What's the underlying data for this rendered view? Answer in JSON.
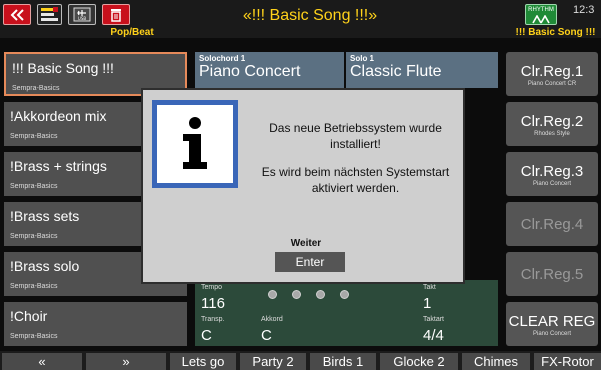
{
  "header": {
    "title": "«!!! Basic Song !!!»",
    "left_label": "Pop/Beat",
    "right_label": "!!! Basic Song !!!",
    "clock": "12:3",
    "icons": [
      "double-left-icon",
      "menu-icon",
      "usb-icon",
      "trash-icon",
      "rhythm-icon"
    ],
    "usb_label": "USB",
    "rhythm_label": "RHYTHM"
  },
  "songs": [
    {
      "name": "!!! Basic Song !!!",
      "sub": "Sempra-Basics",
      "active": true
    },
    {
      "name": "!Akkordeon mix",
      "sub": "Sempra-Basics"
    },
    {
      "name": "!Brass + strings",
      "sub": "Sempra-Basics"
    },
    {
      "name": "!Brass sets",
      "sub": "Sempra-Basics"
    },
    {
      "name": "!Brass solo",
      "sub": "Sempra-Basics"
    },
    {
      "name": "!Choir",
      "sub": "Sempra-Basics"
    }
  ],
  "panels": {
    "solochord_label": "Solochord 1",
    "solochord_value": "Piano Concert",
    "solo_label": "Solo 1",
    "solo_value": "Classic Flute",
    "tempo_label": "Tempo",
    "tempo_value": "116",
    "takt_label": "Takt",
    "takt_value": "1",
    "transp_label": "Transp.",
    "transp_value": "C",
    "akkord_label": "Akkord",
    "akkord_value": "C",
    "taktart_label": "Taktart",
    "taktart_value": "4/4"
  },
  "registrations": [
    {
      "name": "Clr.Reg.1",
      "sub": "Piano Concert CR"
    },
    {
      "name": "Clr.Reg.2",
      "sub": "Rhodes Style"
    },
    {
      "name": "Clr.Reg.3",
      "sub": "Piano Concert"
    },
    {
      "name": "Clr.Reg.4",
      "sub": "",
      "dim": true
    },
    {
      "name": "Clr.Reg.5",
      "sub": "",
      "dim": true
    },
    {
      "name": "CLEAR REG",
      "sub": "Piano Concert"
    }
  ],
  "dialog": {
    "line1": "Das neue Betriebssystem wurde",
    "line2": "installiert!",
    "line3": "Es wird beim nächsten Systemstart",
    "line4": "aktiviert werden.",
    "weiter": "Weiter",
    "enter": "Enter",
    "icon": "info-icon"
  },
  "bottom": {
    "scroll_up": "«",
    "scroll_down": "»",
    "buttons": [
      "Lets go",
      "Party 2",
      "Birds 1",
      "Glocke 2",
      "Chimes",
      "FX-Rotor"
    ]
  },
  "colors": {
    "accent": "#ffd21a",
    "active_border": "#e68a5a",
    "info_blue": "#3a66b8",
    "rhythm_green": "#1f8a37"
  }
}
